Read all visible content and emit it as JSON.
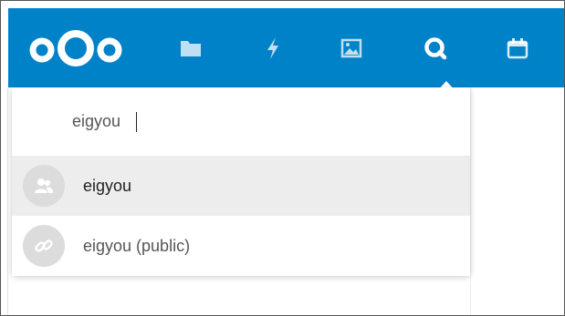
{
  "header": {
    "brand_color": "#0082c9",
    "icons": [
      "nextcloud-logo-icon",
      "files-folder-icon",
      "activity-bolt-icon",
      "gallery-image-icon",
      "search-icon",
      "calendar-icon"
    ]
  },
  "search": {
    "value": "eigyou"
  },
  "results": [
    {
      "label": "eigyou",
      "icon": "user-group-icon"
    },
    {
      "label": "eigyou (public)",
      "icon": "link-icon"
    }
  ]
}
